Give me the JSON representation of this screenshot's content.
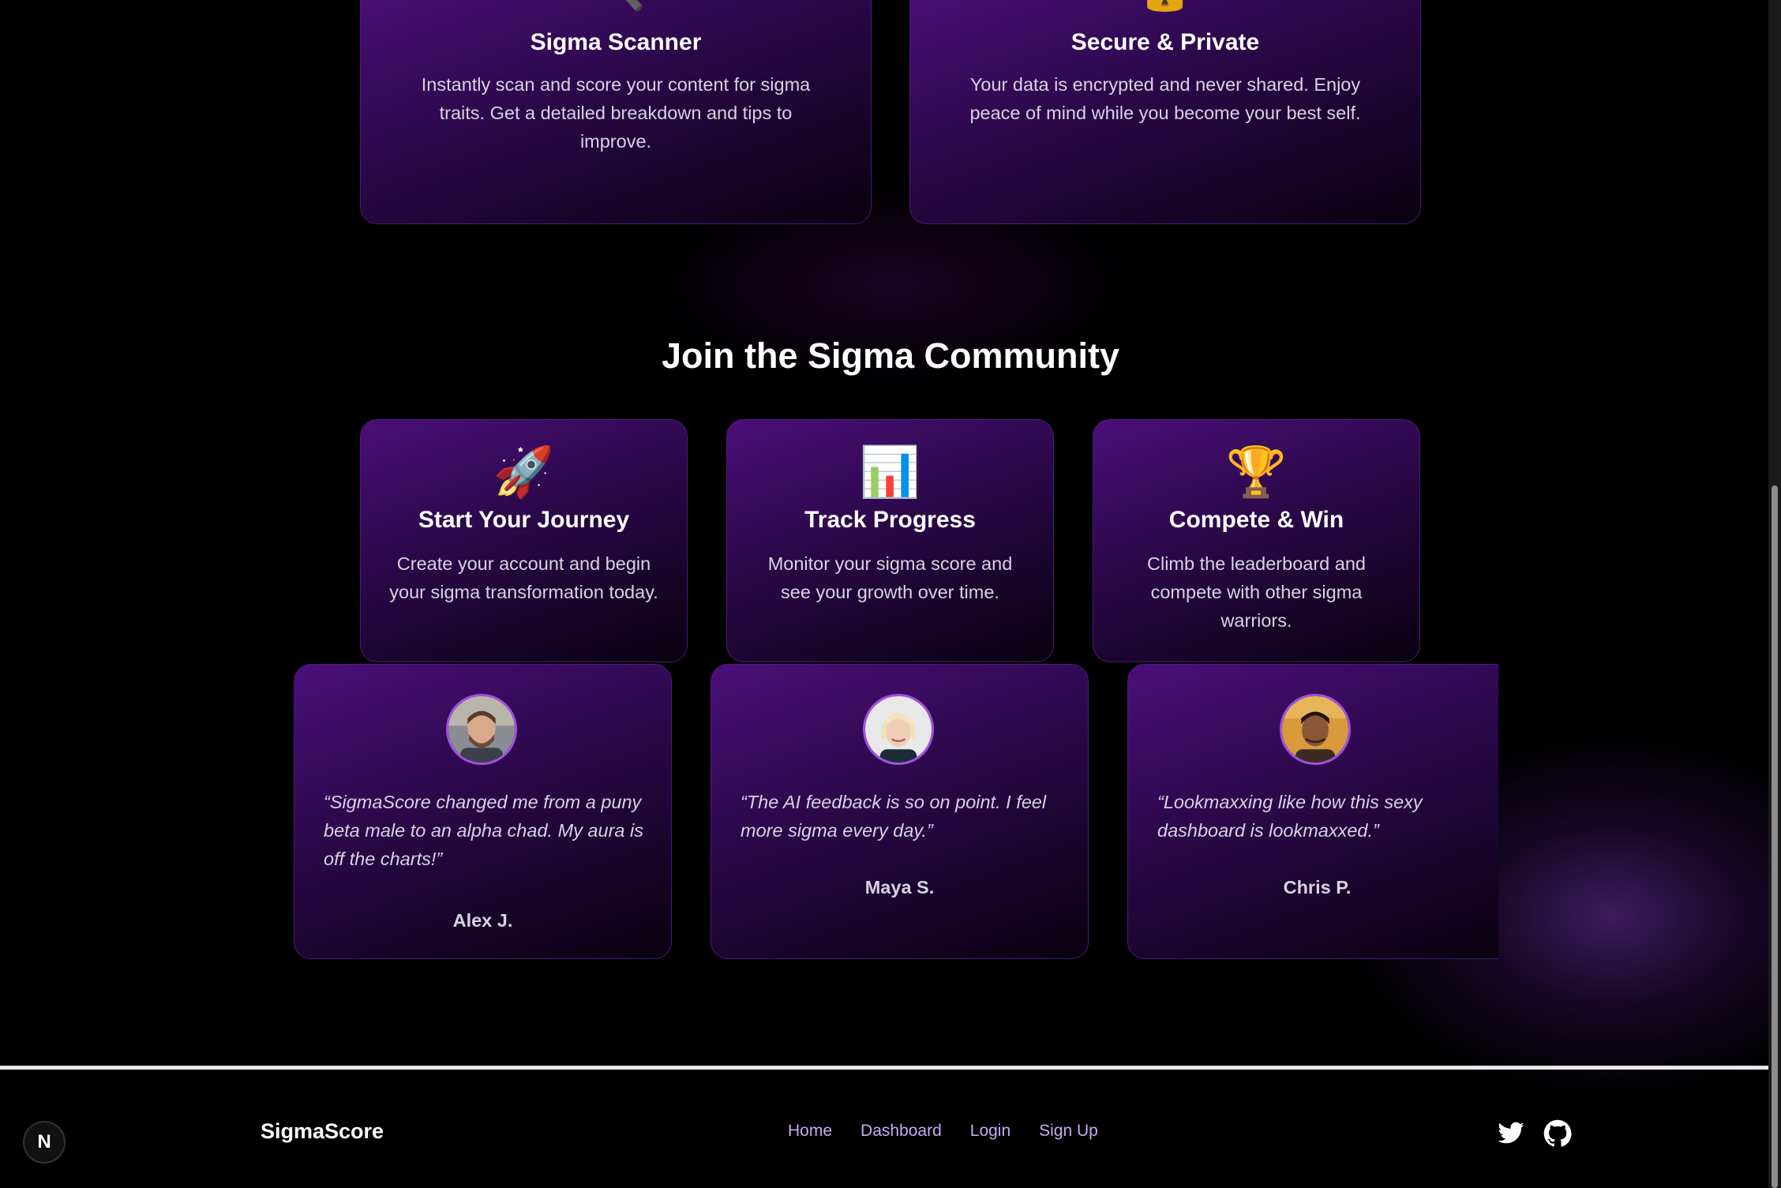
{
  "top_features": [
    {
      "icon": "magnifier",
      "title": "Sigma Scanner",
      "text": "Instantly scan and score your content for sigma traits. Get a detailed breakdown and tips to improve."
    },
    {
      "icon": "lock",
      "title": "Secure & Private",
      "text": "Your data is encrypted and never shared. Enjoy peace of mind while you become your best self."
    }
  ],
  "community": {
    "title": "Join the Sigma Community",
    "cards": [
      {
        "icon": "rocket",
        "title": "Start Your Journey",
        "text": "Create your account and begin your sigma transformation today."
      },
      {
        "icon": "bar-chart",
        "title": "Track Progress",
        "text": "Monitor your sigma score and see your growth over time."
      },
      {
        "icon": "trophy",
        "title": "Compete & Win",
        "text": "Climb the leaderboard and compete with other sigma warriors."
      }
    ]
  },
  "testimonials": [
    {
      "quote": "“SigmaScore changed me from a puny beta male to an alpha chad. My aura is off the charts!”",
      "author": "Alex J."
    },
    {
      "quote": "“The AI feedback is so on point. I feel more sigma every day.”",
      "author": "Maya S."
    },
    {
      "quote": "“Lookmaxxing like how this sexy dashboard is lookmaxxed.”",
      "author": "Chris P."
    }
  ],
  "footer": {
    "brand": "SigmaScore",
    "nav": [
      "Home",
      "Dashboard",
      "Login",
      "Sign Up"
    ],
    "social": [
      "twitter-icon",
      "github-icon"
    ]
  },
  "dev_badge": "N",
  "colors": {
    "background": "#000000",
    "accent": "#c9a9f0",
    "card_purple": "#4b0f7a",
    "avatar_border": "#a050e0"
  }
}
